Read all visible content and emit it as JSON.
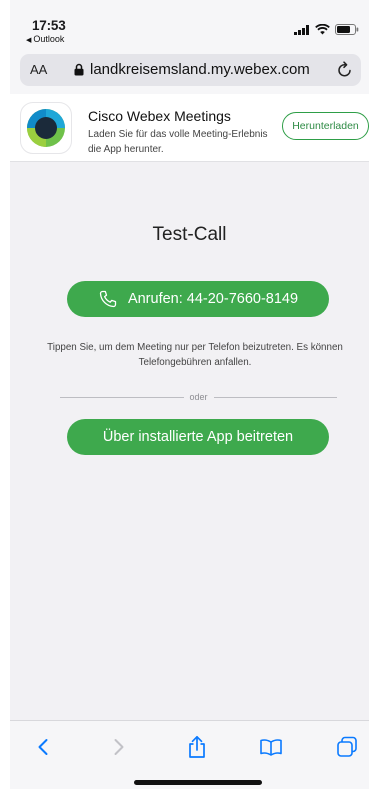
{
  "status_bar": {
    "time": "17:53",
    "back_app": "Outlook",
    "icons": [
      "cellular-signal-icon",
      "wifi-icon",
      "battery-icon"
    ]
  },
  "address_bar": {
    "text_size_label": "AA",
    "url": "landkreisemsland.my.webex.com",
    "lock_icon": "lock-icon",
    "reload_icon": "reload-icon"
  },
  "app_banner": {
    "title": "Cisco Webex Meetings",
    "description": "Laden Sie für das volle Meeting-Erlebnis die App herunter.",
    "download_label": "Herunterladen"
  },
  "main": {
    "title": "Test-Call",
    "call_button_label": "Anrufen: 44-20-7660-8149",
    "hint": "Tippen Sie, um dem Meeting nur per Telefon beizutreten. Es können Telefongebühren anfallen.",
    "separator_label": "oder",
    "app_button_label": "Über installierte App beitreten"
  },
  "toolbar": {
    "items": [
      "back-icon",
      "forward-icon",
      "share-icon",
      "bookmarks-icon",
      "tabs-icon"
    ]
  },
  "colors": {
    "accent_green": "#3ea94d",
    "ios_blue": "#0a7aff",
    "background": "#f2f1f4"
  }
}
